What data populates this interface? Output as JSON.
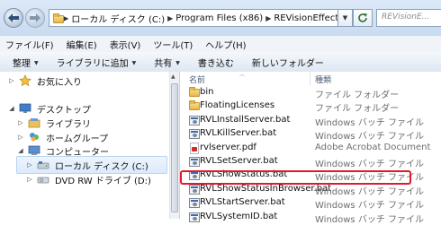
{
  "address_bar": {
    "chevron": "«",
    "breadcrumbs": [
      "ローカル ディスク (C:)",
      "Program Files (x86)",
      "REVisionEffects"
    ],
    "search_placeholder": "REVisionE..."
  },
  "menu": [
    "ファイル(F)",
    "編集(E)",
    "表示(V)",
    "ツール(T)",
    "ヘルプ(H)"
  ],
  "commands": [
    {
      "label": "整理",
      "dropdown": true
    },
    {
      "label": "ライブラリに追加",
      "dropdown": true
    },
    {
      "label": "共有",
      "dropdown": true
    },
    {
      "label": "書き込む",
      "dropdown": false
    },
    {
      "label": "新しいフォルダー",
      "dropdown": false
    }
  ],
  "nav": {
    "favorites": "お気に入り",
    "desktop": "デスクトップ",
    "libraries": "ライブラリ",
    "homegroup": "ホームグループ",
    "computer": "コンピューター",
    "local_disk": "ローカル ディスク (C:)",
    "dvd": "DVD RW ドライブ (D:)"
  },
  "columns": {
    "name": "名前",
    "type": "種類"
  },
  "files": [
    {
      "name": "bin",
      "type": "ファイル フォルダー",
      "icon": "folder-icon"
    },
    {
      "name": "FloatingLicenses",
      "type": "ファイル フォルダー",
      "icon": "folder-icon"
    },
    {
      "name": "RVLInstallServer.bat",
      "type": "Windows バッチ ファイル",
      "icon": "batch-file-icon"
    },
    {
      "name": "RVLKillServer.bat",
      "type": "Windows バッチ ファイル",
      "icon": "batch-file-icon"
    },
    {
      "name": "rvlserver.pdf",
      "type": "Adobe Acrobat Document",
      "icon": "pdf-file-icon"
    },
    {
      "name": "RVLSetServer.bat",
      "type": "Windows バッチ ファイル",
      "icon": "batch-file-icon"
    },
    {
      "name": "RVLShowStatus.bat",
      "type": "Windows バッチ ファイル",
      "icon": "batch-file-icon"
    },
    {
      "name": "RVLShowStatusInBrowser.bat",
      "type": "Windows バッチ ファイル",
      "icon": "batch-file-icon"
    },
    {
      "name": "RVLStartServer.bat",
      "type": "Windows バッチ ファイル",
      "icon": "batch-file-icon"
    },
    {
      "name": "RVLSystemID.bat",
      "type": "Windows バッチ ファイル",
      "icon": "batch-file-icon"
    }
  ],
  "highlighted_file": "RVLShowStatusInBrowser.bat",
  "colors": {
    "highlight": "#e0192c",
    "selection": "#dbeafc",
    "column_header": "#4c607a"
  }
}
